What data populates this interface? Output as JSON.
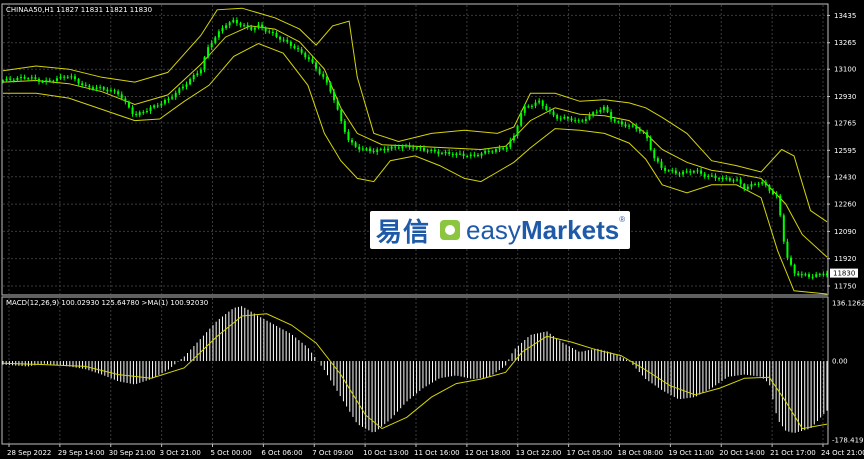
{
  "header": {
    "symbol_line": "CHINAA50,H1  11827 11831 11821 11830",
    "macd_line": "MACD(12,26,9)  100.02930  125.64780  >MA(1)  100.92030"
  },
  "logo": {
    "cn_text": "易信",
    "en_prefix": "easy",
    "en_suffix": "Markets",
    "reg": "®"
  },
  "colors": {
    "background": "#000000",
    "candles": "#00ff00",
    "bands": "#d4d40a",
    "histogram": "#ffffff",
    "signal": "#d4d40a",
    "grid": "#3a3a3a",
    "border": "#bfbfbf"
  },
  "chart_data": [
    {
      "type": "line",
      "name_text": "CHINAA50,H1",
      "ylim": [
        11700,
        13500
      ],
      "y_ticks": [
        "13435",
        "13265",
        "13100",
        "12930",
        "12765",
        "12595",
        "12430",
        "12260",
        "12090",
        "11920",
        "11750"
      ],
      "y_tick_values": [
        13435,
        13265,
        13100,
        12930,
        12765,
        12595,
        12430,
        12260,
        12090,
        11920,
        11750
      ],
      "current_price_label": "11830",
      "current_price": 11830,
      "x_ticks": [
        "28 Sep 2022",
        "29 Sep 14:00",
        "30 Sep 21:00",
        "3 Oct 21:00",
        "5 Oct 00:00",
        "6 Oct 06:00",
        "7 Oct 09:00",
        "10 Oct 13:00",
        "11 Oct 16:00",
        "12 Oct 18:00",
        "13 Oct 22:00",
        "17 Oct 05:00",
        "18 Oct 08:00",
        "19 Oct 11:00",
        "20 Oct 14:00",
        "21 Oct 17:00",
        "24 Oct 21:00"
      ],
      "price": [
        [
          0,
          13030
        ],
        [
          0.03,
          13050
        ],
        [
          0.05,
          13020
        ],
        [
          0.08,
          13060
        ],
        [
          0.1,
          12990
        ],
        [
          0.12,
          12980
        ],
        [
          0.14,
          12950
        ],
        [
          0.15,
          12880
        ],
        [
          0.16,
          12810
        ],
        [
          0.18,
          12860
        ],
        [
          0.2,
          12910
        ],
        [
          0.22,
          13000
        ],
        [
          0.24,
          13100
        ],
        [
          0.25,
          13250
        ],
        [
          0.27,
          13380
        ],
        [
          0.28,
          13400
        ],
        [
          0.3,
          13350
        ],
        [
          0.31,
          13370
        ],
        [
          0.33,
          13310
        ],
        [
          0.35,
          13250
        ],
        [
          0.37,
          13170
        ],
        [
          0.39,
          13040
        ],
        [
          0.4,
          12940
        ],
        [
          0.41,
          12780
        ],
        [
          0.42,
          12650
        ],
        [
          0.43,
          12610
        ],
        [
          0.45,
          12590
        ],
        [
          0.47,
          12610
        ],
        [
          0.49,
          12620
        ],
        [
          0.51,
          12600
        ],
        [
          0.53,
          12580
        ],
        [
          0.55,
          12570
        ],
        [
          0.57,
          12560
        ],
        [
          0.59,
          12590
        ],
        [
          0.61,
          12610
        ],
        [
          0.62,
          12680
        ],
        [
          0.63,
          12850
        ],
        [
          0.65,
          12900
        ],
        [
          0.67,
          12800
        ],
        [
          0.69,
          12790
        ],
        [
          0.7,
          12770
        ],
        [
          0.72,
          12840
        ],
        [
          0.73,
          12860
        ],
        [
          0.74,
          12780
        ],
        [
          0.75,
          12760
        ],
        [
          0.77,
          12730
        ],
        [
          0.78,
          12690
        ],
        [
          0.79,
          12550
        ],
        [
          0.8,
          12480
        ],
        [
          0.82,
          12450
        ],
        [
          0.84,
          12470
        ],
        [
          0.85,
          12440
        ],
        [
          0.87,
          12420
        ],
        [
          0.89,
          12410
        ],
        [
          0.9,
          12360
        ],
        [
          0.92,
          12400
        ],
        [
          0.94,
          12300
        ],
        [
          0.95,
          11950
        ],
        [
          0.96,
          11830
        ],
        [
          0.98,
          11810
        ],
        [
          1.0,
          11830
        ]
      ],
      "bb_upper": [
        [
          0,
          13090
        ],
        [
          0.04,
          13120
        ],
        [
          0.08,
          13100
        ],
        [
          0.12,
          13050
        ],
        [
          0.16,
          13020
        ],
        [
          0.2,
          13080
        ],
        [
          0.24,
          13310
        ],
        [
          0.26,
          13470
        ],
        [
          0.29,
          13480
        ],
        [
          0.33,
          13420
        ],
        [
          0.36,
          13350
        ],
        [
          0.38,
          13250
        ],
        [
          0.4,
          13370
        ],
        [
          0.42,
          13400
        ],
        [
          0.43,
          13050
        ],
        [
          0.45,
          12700
        ],
        [
          0.48,
          12650
        ],
        [
          0.52,
          12700
        ],
        [
          0.56,
          12720
        ],
        [
          0.6,
          12700
        ],
        [
          0.62,
          12740
        ],
        [
          0.64,
          12950
        ],
        [
          0.67,
          12950
        ],
        [
          0.7,
          12900
        ],
        [
          0.73,
          12910
        ],
        [
          0.76,
          12890
        ],
        [
          0.78,
          12860
        ],
        [
          0.8,
          12800
        ],
        [
          0.83,
          12700
        ],
        [
          0.86,
          12530
        ],
        [
          0.89,
          12500
        ],
        [
          0.92,
          12460
        ],
        [
          0.945,
          12600
        ],
        [
          0.96,
          12560
        ],
        [
          0.98,
          12220
        ],
        [
          1.0,
          12150
        ]
      ],
      "bb_middle": [
        [
          0,
          13020
        ],
        [
          0.04,
          13030
        ],
        [
          0.08,
          13010
        ],
        [
          0.12,
          12960
        ],
        [
          0.16,
          12880
        ],
        [
          0.2,
          12940
        ],
        [
          0.24,
          13130
        ],
        [
          0.27,
          13300
        ],
        [
          0.3,
          13370
        ],
        [
          0.33,
          13350
        ],
        [
          0.36,
          13270
        ],
        [
          0.39,
          13100
        ],
        [
          0.41,
          12860
        ],
        [
          0.43,
          12700
        ],
        [
          0.46,
          12630
        ],
        [
          0.5,
          12620
        ],
        [
          0.54,
          12610
        ],
        [
          0.58,
          12600
        ],
        [
          0.61,
          12620
        ],
        [
          0.64,
          12780
        ],
        [
          0.67,
          12860
        ],
        [
          0.7,
          12820
        ],
        [
          0.73,
          12810
        ],
        [
          0.76,
          12780
        ],
        [
          0.78,
          12700
        ],
        [
          0.8,
          12600
        ],
        [
          0.83,
          12520
        ],
        [
          0.86,
          12470
        ],
        [
          0.89,
          12450
        ],
        [
          0.92,
          12420
        ],
        [
          0.95,
          12260
        ],
        [
          0.97,
          12070
        ],
        [
          1.0,
          11930
        ]
      ],
      "bb_lower": [
        [
          0,
          12950
        ],
        [
          0.04,
          12950
        ],
        [
          0.08,
          12920
        ],
        [
          0.12,
          12850
        ],
        [
          0.16,
          12780
        ],
        [
          0.19,
          12790
        ],
        [
          0.22,
          12900
        ],
        [
          0.25,
          13000
        ],
        [
          0.28,
          13180
        ],
        [
          0.31,
          13260
        ],
        [
          0.34,
          13200
        ],
        [
          0.37,
          13000
        ],
        [
          0.39,
          12700
        ],
        [
          0.41,
          12530
        ],
        [
          0.43,
          12420
        ],
        [
          0.45,
          12400
        ],
        [
          0.47,
          12530
        ],
        [
          0.5,
          12560
        ],
        [
          0.53,
          12500
        ],
        [
          0.56,
          12420
        ],
        [
          0.58,
          12400
        ],
        [
          0.6,
          12460
        ],
        [
          0.62,
          12520
        ],
        [
          0.64,
          12610
        ],
        [
          0.67,
          12730
        ],
        [
          0.7,
          12720
        ],
        [
          0.73,
          12700
        ],
        [
          0.76,
          12640
        ],
        [
          0.78,
          12540
        ],
        [
          0.8,
          12380
        ],
        [
          0.83,
          12330
        ],
        [
          0.86,
          12380
        ],
        [
          0.89,
          12380
        ],
        [
          0.92,
          12300
        ],
        [
          0.94,
          11970
        ],
        [
          0.96,
          11720
        ],
        [
          1.0,
          11700
        ]
      ]
    },
    {
      "type": "bar",
      "name_text": "MACD(12,26,9)",
      "ylim": [
        -182,
        140
      ],
      "y_ticks": [
        "136.12620",
        "0.00",
        "-178.41920"
      ],
      "y_tick_values": [
        136.1262,
        0,
        -178.4192
      ],
      "histogram": [
        [
          0,
          -8
        ],
        [
          0.03,
          -12
        ],
        [
          0.05,
          -6
        ],
        [
          0.08,
          -12
        ],
        [
          0.1,
          -18
        ],
        [
          0.12,
          -30
        ],
        [
          0.14,
          -45
        ],
        [
          0.16,
          -52
        ],
        [
          0.18,
          -40
        ],
        [
          0.2,
          -20
        ],
        [
          0.22,
          10
        ],
        [
          0.24,
          50
        ],
        [
          0.26,
          90
        ],
        [
          0.28,
          118
        ],
        [
          0.29,
          122
        ],
        [
          0.31,
          100
        ],
        [
          0.33,
          80
        ],
        [
          0.35,
          60
        ],
        [
          0.37,
          30
        ],
        [
          0.39,
          -20
        ],
        [
          0.41,
          -80
        ],
        [
          0.43,
          -140
        ],
        [
          0.45,
          -160
        ],
        [
          0.47,
          -130
        ],
        [
          0.49,
          -90
        ],
        [
          0.51,
          -60
        ],
        [
          0.53,
          -38
        ],
        [
          0.55,
          -32
        ],
        [
          0.57,
          -40
        ],
        [
          0.59,
          -36
        ],
        [
          0.61,
          -10
        ],
        [
          0.62,
          25
        ],
        [
          0.64,
          58
        ],
        [
          0.66,
          66
        ],
        [
          0.68,
          40
        ],
        [
          0.7,
          20
        ],
        [
          0.72,
          28
        ],
        [
          0.74,
          18
        ],
        [
          0.76,
          0
        ],
        [
          0.78,
          -40
        ],
        [
          0.8,
          -65
        ],
        [
          0.82,
          -85
        ],
        [
          0.84,
          -80
        ],
        [
          0.86,
          -60
        ],
        [
          0.88,
          -35
        ],
        [
          0.9,
          -30
        ],
        [
          0.92,
          -35
        ],
        [
          0.93,
          -50
        ],
        [
          0.94,
          -130
        ],
        [
          0.95,
          -155
        ],
        [
          0.96,
          -160
        ],
        [
          0.98,
          -150
        ],
        [
          1.0,
          -110
        ]
      ],
      "signal": [
        [
          0,
          -5
        ],
        [
          0.05,
          -8
        ],
        [
          0.1,
          -12
        ],
        [
          0.14,
          -30
        ],
        [
          0.18,
          -38
        ],
        [
          0.22,
          -15
        ],
        [
          0.26,
          55
        ],
        [
          0.29,
          100
        ],
        [
          0.32,
          105
        ],
        [
          0.35,
          80
        ],
        [
          0.38,
          40
        ],
        [
          0.41,
          -30
        ],
        [
          0.44,
          -120
        ],
        [
          0.46,
          -150
        ],
        [
          0.49,
          -125
        ],
        [
          0.52,
          -80
        ],
        [
          0.55,
          -50
        ],
        [
          0.58,
          -40
        ],
        [
          0.61,
          -25
        ],
        [
          0.63,
          20
        ],
        [
          0.66,
          55
        ],
        [
          0.69,
          42
        ],
        [
          0.72,
          25
        ],
        [
          0.75,
          12
        ],
        [
          0.78,
          -20
        ],
        [
          0.81,
          -55
        ],
        [
          0.84,
          -75
        ],
        [
          0.87,
          -60
        ],
        [
          0.9,
          -38
        ],
        [
          0.93,
          -36
        ],
        [
          0.95,
          -90
        ],
        [
          0.97,
          -150
        ],
        [
          1.0,
          -140
        ]
      ]
    }
  ]
}
